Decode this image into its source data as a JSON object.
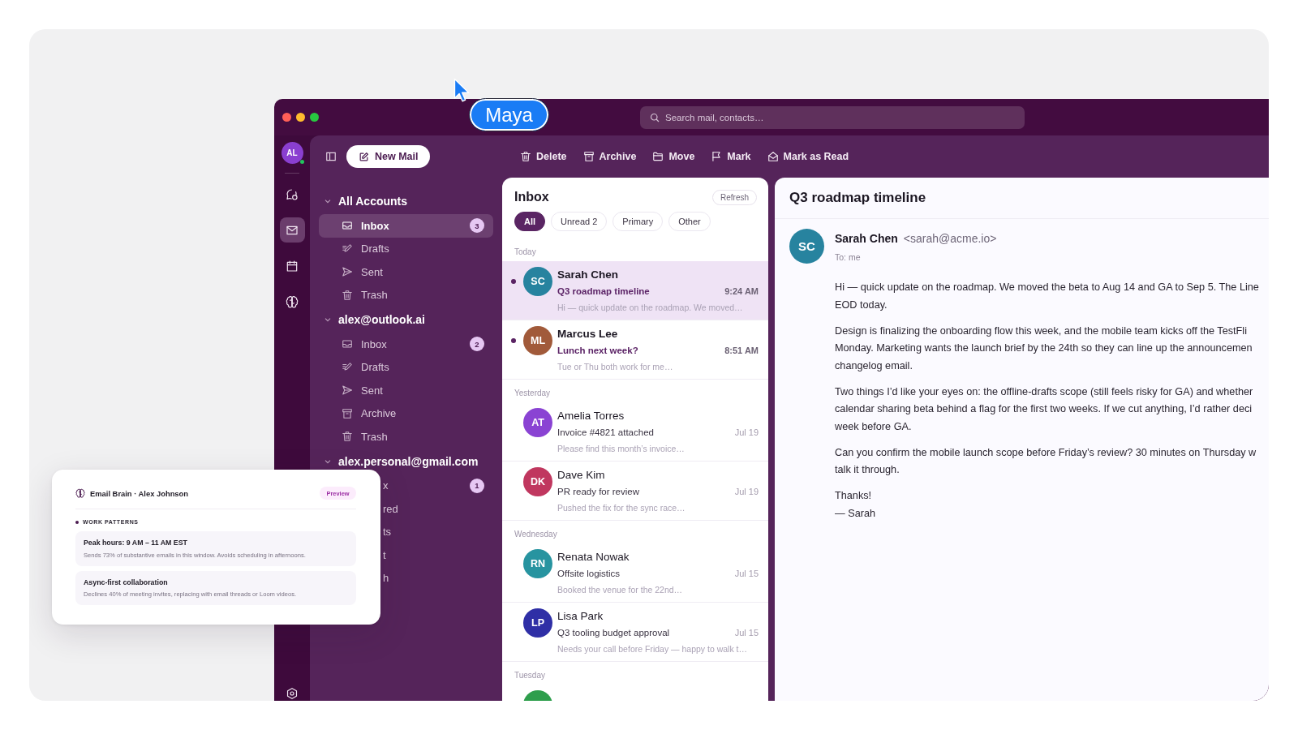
{
  "cursor": {
    "name": "Maya"
  },
  "window": {
    "search": {
      "placeholder": "Search mail, contacts…"
    }
  },
  "rail": {
    "avatar": {
      "initials": "AL",
      "online": true
    },
    "items": [
      {
        "kind": "chat",
        "selected": false
      },
      {
        "kind": "mail",
        "selected": true
      },
      {
        "kind": "calendar",
        "selected": false
      },
      {
        "kind": "brain",
        "selected": false
      }
    ],
    "bottom_items": [
      {
        "kind": "settings",
        "selected": false
      }
    ]
  },
  "sidebar": {
    "new_mail_button": "New Mail",
    "accounts": [
      {
        "name": "All Accounts",
        "expanded": true,
        "folders": [
          {
            "kind": "inbox",
            "label": "Inbox",
            "badge": "3",
            "selected": true
          },
          {
            "kind": "drafts",
            "label": "Drafts",
            "selected": false
          },
          {
            "kind": "sent",
            "label": "Sent",
            "selected": false
          },
          {
            "kind": "trash",
            "label": "Trash",
            "selected": false
          }
        ]
      },
      {
        "name": "alex@outlook.ai",
        "expanded": true,
        "folders": [
          {
            "kind": "inbox",
            "label": "Inbox",
            "badge": "2",
            "selected": false
          },
          {
            "kind": "drafts",
            "label": "Drafts",
            "selected": false
          },
          {
            "kind": "sent",
            "label": "Sent",
            "selected": false
          },
          {
            "kind": "archive",
            "label": "Archive",
            "selected": false
          },
          {
            "kind": "trash",
            "label": "Trash",
            "selected": false
          }
        ]
      },
      {
        "name": "alex.personal@gmail.com",
        "expanded": true,
        "folders": [
          {
            "kind": "partial",
            "label": "x",
            "badge": "1",
            "selected": false
          },
          {
            "kind": "partial",
            "label": "red",
            "selected": false
          },
          {
            "kind": "partial",
            "label": "ts",
            "selected": false
          },
          {
            "kind": "partial",
            "label": "t",
            "selected": false
          },
          {
            "kind": "partial",
            "label": "h",
            "selected": false
          }
        ]
      }
    ]
  },
  "toolbar": [
    {
      "kind": "delete",
      "label": "Delete"
    },
    {
      "kind": "archive",
      "label": "Archive"
    },
    {
      "kind": "move",
      "label": "Move"
    },
    {
      "kind": "mark",
      "label": "Mark"
    },
    {
      "kind": "mark_read",
      "label": "Mark as Read"
    }
  ],
  "inbox": {
    "title": "Inbox",
    "refresh_button": "Refresh",
    "filters": [
      {
        "label": "All",
        "selected": true
      },
      {
        "label": "Unread 2",
        "selected": false
      },
      {
        "label": "Primary",
        "selected": false
      },
      {
        "label": "Other",
        "selected": false
      }
    ],
    "groups": [
      {
        "label": "Today",
        "emails": [
          {
            "initials": "SC",
            "color": "#27839f",
            "name": "Sarah Chen",
            "subject": "Q3 roadmap timeline",
            "time": "9:24 AM",
            "preview": "Hi — quick update on the roadmap. We moved…",
            "unread": true,
            "selected": true
          },
          {
            "initials": "ML",
            "color": "#a15a3a",
            "name": "Marcus Lee",
            "subject": "Lunch next week?",
            "time": "8:51 AM",
            "preview": "Tue or Thu both work for me…",
            "unread": true,
            "selected": false
          }
        ]
      },
      {
        "label": "Yesterday",
        "emails": [
          {
            "initials": "AT",
            "color": "#8a43d3",
            "name": "Amelia Torres",
            "subject": "Invoice #4821 attached",
            "time": "Jul 19",
            "preview": "Please find this month’s invoice…",
            "unread": false,
            "selected": false
          },
          {
            "initials": "DK",
            "color": "#c0375f",
            "name": "Dave Kim",
            "subject": "PR ready for review",
            "time": "Jul 19",
            "preview": "Pushed the fix for the sync race…",
            "unread": false,
            "selected": false
          }
        ]
      },
      {
        "label": "Wednesday",
        "emails": [
          {
            "initials": "RN",
            "color": "#2794a0",
            "name": "Renata Nowak",
            "subject": "Offsite logistics",
            "time": "Jul 15",
            "preview": "Booked the venue for the 22nd…",
            "unread": false,
            "selected": false
          },
          {
            "initials": "LP",
            "color": "#2f2fa6",
            "name": "Lisa Park",
            "subject": "Q3 tooling budget approval",
            "time": "Jul 15",
            "preview": "Needs your call before Friday — happy to walk t…",
            "unread": false,
            "selected": false
          }
        ]
      },
      {
        "label": "Tuesday",
        "emails": [
          {
            "color": "#2e9e4c",
            "unread": false,
            "selected": false
          }
        ]
      }
    ]
  },
  "message": {
    "subject": "Q3 roadmap timeline",
    "sender": {
      "initials": "SC",
      "name": "Sarah Chen",
      "email": "<sarah@acme.io>"
    },
    "to": "To: me",
    "paragraphs": [
      "Hi — quick update on the roadmap. We moved the beta to Aug 14 and GA to Sep 5. The Line\nEOD today.",
      "Design is finalizing the onboarding flow this week, and the mobile team kicks off the TestFli\nMonday. Marketing wants the launch brief by the 24th so they can line up the announcemen\nchangelog email.",
      "Two things I’d like your eyes on: the offline-drafts scope (still feels risky for GA) and whether\ncalendar sharing beta behind a flag for the first two weeks. If we cut anything, I’d rather deci\nweek before GA.",
      "Can you confirm the mobile launch scope before Friday’s review? 30 minutes on Thursday w\ntalk it through.",
      "Thanks!\n— Sarah"
    ]
  },
  "brain_card": {
    "title": "Email Brain · Alex Johnson",
    "badge": "Preview",
    "section": "WORK PATTERNS",
    "insights": [
      {
        "title": "Peak hours: 9 AM – 11 AM EST",
        "text": "Sends 73% of substantive emails in this window. Avoids scheduling in afternoons."
      },
      {
        "title": "Async-first collaboration",
        "text": "Declines 40% of meeting invites, replacing with email threads or Loom videos."
      }
    ]
  }
}
